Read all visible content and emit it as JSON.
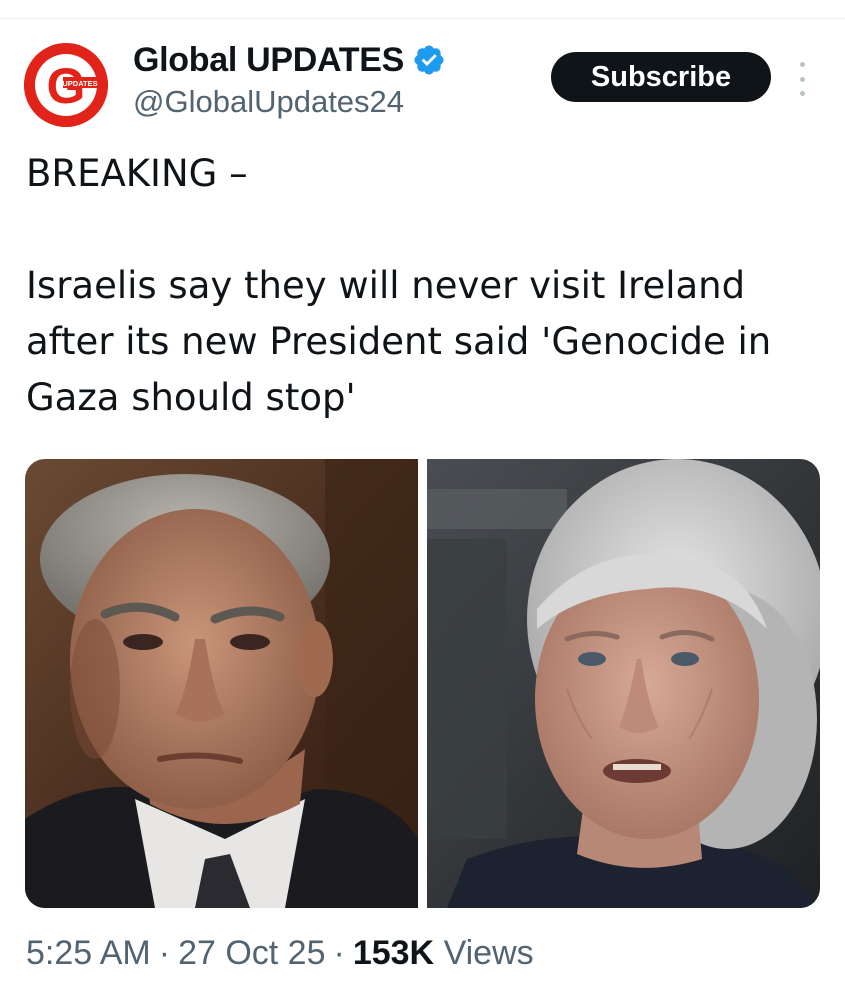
{
  "tweet": {
    "author": {
      "display_name": "Global UPDATES",
      "handle": "@GlobalUpdates24",
      "verified": true,
      "avatar_letter": "G",
      "avatar_text": "UPDATES",
      "avatar_color": "#e2231a"
    },
    "subscribe_label": "Subscribe",
    "more_icon": "more-options-icon",
    "text": {
      "line1": "BREAKING –",
      "line2": "Israelis say they will never visit Ireland after its new President said 'Genocide in Gaza should stop'"
    },
    "media": [
      {
        "kind": "photo"
      },
      {
        "kind": "photo"
      }
    ],
    "meta": {
      "time": "5:25 AM",
      "date": "27 Oct 25",
      "views_count": "153K",
      "views_label": "Views",
      "separator": "·"
    }
  },
  "colors": {
    "text_primary": "#0f1419",
    "text_secondary": "#536471",
    "verified_blue": "#1d9bf0",
    "button_bg": "#0f1419"
  }
}
